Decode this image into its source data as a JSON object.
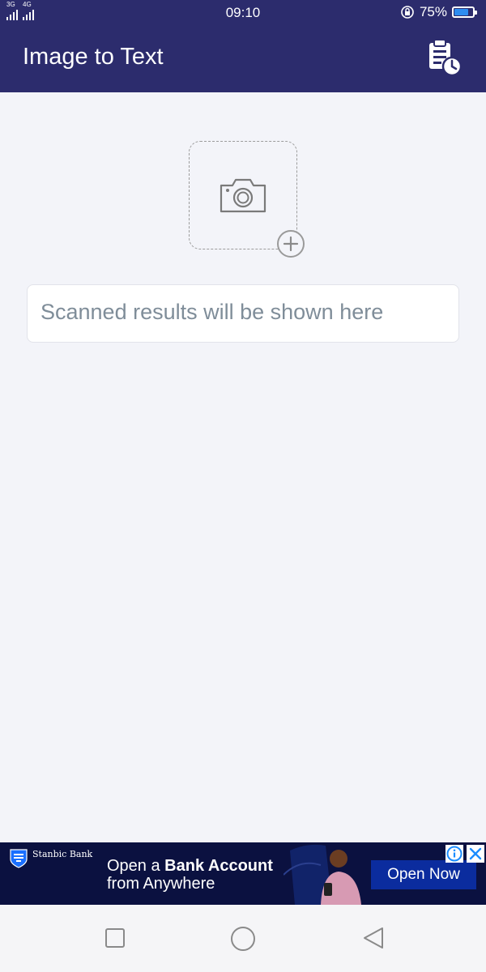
{
  "status_bar": {
    "signal1_label": "3G",
    "signal2_label": "4G",
    "time": "09:10",
    "battery_percent": "75%",
    "battery_level": 0.75
  },
  "app_bar": {
    "title": "Image to Text",
    "history_icon": "clipboard-clock-icon"
  },
  "upload": {
    "icon": "camera-icon",
    "badge_icon": "plus-circle-icon"
  },
  "results": {
    "placeholder": "Scanned results will be shown here"
  },
  "ad": {
    "brand": "Stanbic Bank",
    "headline_prefix": "Open a ",
    "headline_bold": "Bank Account",
    "headline_suffix": "from Anywhere",
    "cta_label": "Open Now",
    "info_icon": "info-icon",
    "close_icon": "close-icon",
    "colors": {
      "background": "#0b1140",
      "cta": "#0b2c9e",
      "accent": "#1a8cff"
    }
  },
  "nav": {
    "recents_icon": "square-icon",
    "home_icon": "circle-icon",
    "back_icon": "triangle-back-icon"
  },
  "colors": {
    "primary": "#2c2c6d",
    "background": "#f3f4f9",
    "placeholder_text": "#7f8d99"
  }
}
